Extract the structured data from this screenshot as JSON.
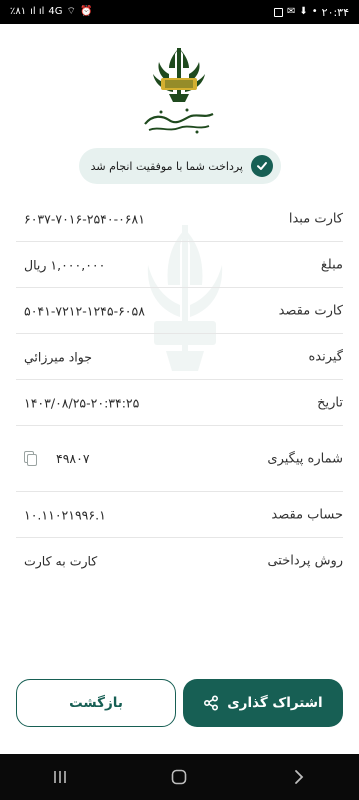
{
  "status_bar": {
    "time": "۲۰:۳۴",
    "battery": "٪۸۱",
    "network": "4G"
  },
  "bank": {
    "name": "بانک کشاورزی",
    "logo_caption": "بانک کشاورزی"
  },
  "success_message": "پرداخت شما با موفقیت انجام شد",
  "details": [
    {
      "label": "کارت مبدا",
      "value": "۶۰۳۷-۷۰۱۶-۲۵۴۰-۰۶۸۱"
    },
    {
      "label": "مبلغ",
      "value": "۱,۰۰۰,۰۰۰ ریال"
    },
    {
      "label": "کارت مقصد",
      "value": "۵۰۴۱-۷۲۱۲-۱۲۴۵-۶۰۵۸"
    },
    {
      "label": "گیرنده",
      "value": "جواد میرزائي"
    },
    {
      "label": "تاریخ",
      "value": "۱۴۰۳/۰۸/۲۵-۲۰:۳۴:۲۵"
    },
    {
      "label": "شماره پیگیری",
      "value": "۴۹۸۰۷",
      "icon": "copy-icon"
    },
    {
      "label": "حساب مقصد",
      "value": "۱۰.۱۱۰۲۱۹۹۶.۱"
    },
    {
      "label": "روش پرداختی",
      "value": "کارت به کارت"
    }
  ],
  "buttons": {
    "back": "بازگشت",
    "share": "اشتراک گذاری"
  },
  "colors": {
    "primary": "#175f54",
    "success_bg": "#e7f1ef",
    "logo_green": "#1f4a1e",
    "logo_gold": "#d4b030"
  },
  "icons": {
    "success": "check-circle-icon",
    "copy": "copy-icon",
    "share": "share-icon"
  }
}
